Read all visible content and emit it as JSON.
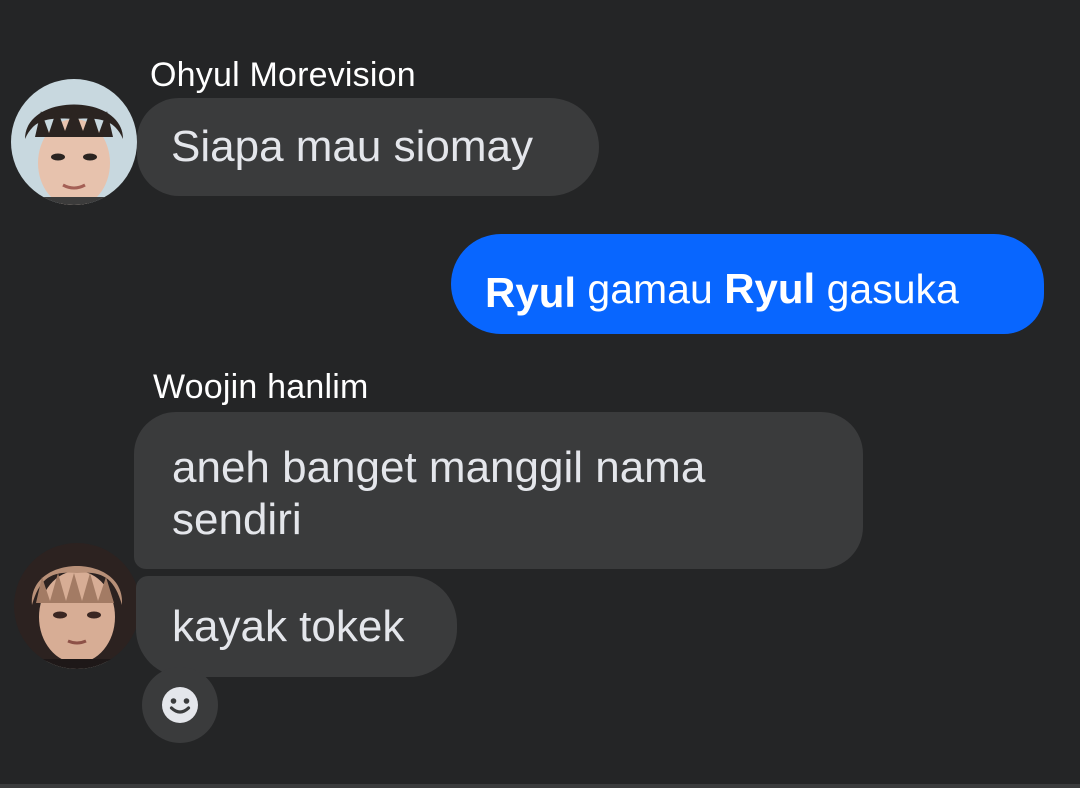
{
  "conversation": {
    "messages": [
      {
        "sender": "Ohyul Morevision",
        "text": "Siapa mau siomay",
        "direction": "incoming"
      },
      {
        "sender": "",
        "text_parts": [
          "Ryul",
          "gamau",
          "Ryul",
          "gasuka"
        ],
        "direction": "outgoing"
      },
      {
        "sender": "Woojin hanlim",
        "text": "aneh banget manggil nama sendiri",
        "direction": "incoming"
      },
      {
        "sender": "Woojin hanlim",
        "text": "kayak tokek",
        "direction": "incoming"
      }
    ],
    "reaction_button": {
      "icon": "smiley-face-icon"
    }
  },
  "colors": {
    "background": "#242526",
    "incoming_bubble": "#3a3b3c",
    "outgoing_bubble": "#0866ff",
    "incoming_text": "#e4e6eb",
    "outgoing_text": "#ffffff"
  }
}
